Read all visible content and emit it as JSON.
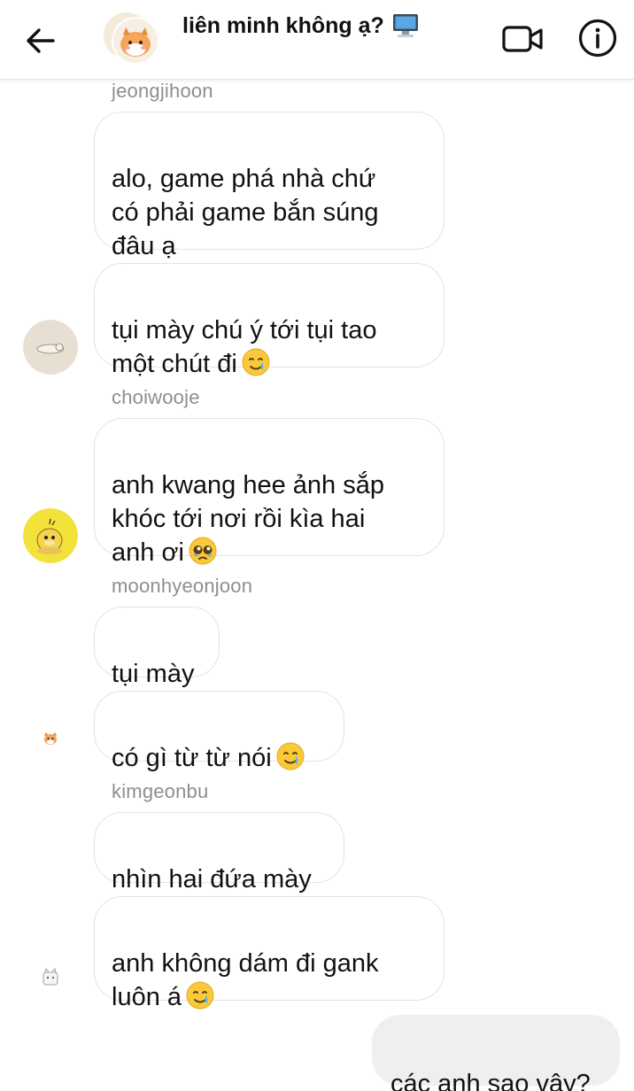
{
  "header": {
    "title": "liên minh không ạ?",
    "title_emoji": "desktop-computer-icon",
    "back": "arrow-left-icon",
    "video": "video-camera-icon",
    "info": "info-icon"
  },
  "messages": [
    {
      "sender": "jeongjihoon",
      "text": "alo, game phá nhà chứ\ncó phải game bắn súng\nđâu ạ",
      "emoji": ""
    },
    {
      "sender": "",
      "text": "tụi mày chú ý tới tụi tao\nmột chút đi",
      "emoji": "smiling-face-with-tear"
    },
    {
      "sender": "choiwooje",
      "text": "anh kwang hee ảnh sắp\nkhóc tới nơi rồi kìa hai\nanh ơi",
      "emoji": "pleading-face"
    },
    {
      "sender": "moonhyeonjoon",
      "text": "tụi mày",
      "emoji": ""
    },
    {
      "sender": "",
      "text": "có gì từ từ nói",
      "emoji": "smiling-face-with-tear"
    },
    {
      "sender": "kimgeonbu",
      "text": "nhìn hai đứa mày",
      "emoji": ""
    },
    {
      "sender": "",
      "text": "anh không dám đi gank\nluôn á",
      "emoji": "smiling-face-with-tear"
    },
    {
      "sender": "me",
      "text": "các anh sao vậy?",
      "emoji": ""
    }
  ],
  "colors": {
    "bubble_border": "#e3e3e3",
    "my_bubble": "#efefef",
    "sender_text": "#8e8e8e"
  }
}
